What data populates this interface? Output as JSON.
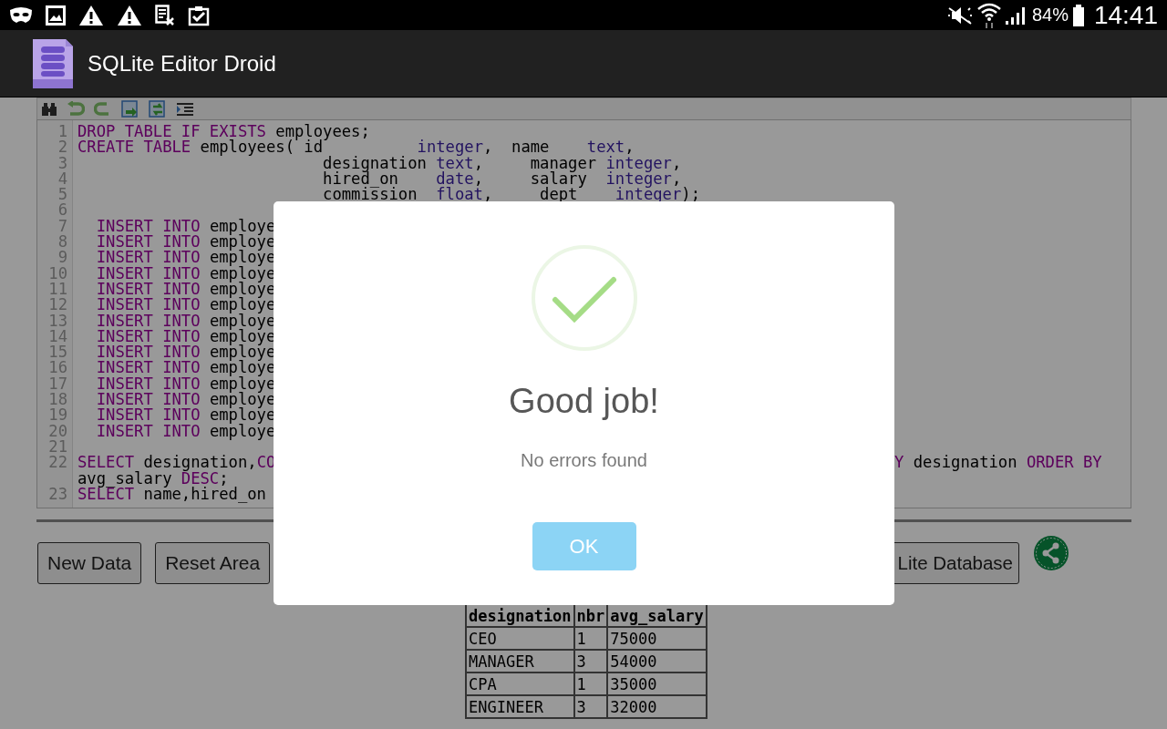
{
  "status_bar": {
    "battery": "84%",
    "time": "14:41"
  },
  "app_bar": {
    "title": "SQLite Editor Droid"
  },
  "editor": {
    "lines": [
      {
        "number": "1",
        "parts": [
          {
            "text": "DROP TABLE IF EXISTS",
            "kind": "keyword"
          },
          {
            "text": " employees;",
            "kind": "plain"
          }
        ]
      },
      {
        "number": "2",
        "parts": [
          {
            "text": "CREATE TABLE",
            "kind": "keyword"
          },
          {
            "text": " employees( id          ",
            "kind": "plain"
          },
          {
            "text": "integer",
            "kind": "type"
          },
          {
            "text": ",  name    ",
            "kind": "plain"
          },
          {
            "text": "text",
            "kind": "type"
          },
          {
            "text": ",",
            "kind": "plain"
          }
        ]
      },
      {
        "number": "3",
        "parts": [
          {
            "text": "                          designation ",
            "kind": "plain"
          },
          {
            "text": "text",
            "kind": "type"
          },
          {
            "text": ",     manager ",
            "kind": "plain"
          },
          {
            "text": "integer",
            "kind": "type"
          },
          {
            "text": ",",
            "kind": "plain"
          }
        ]
      },
      {
        "number": "4",
        "parts": [
          {
            "text": "                          hired_on    ",
            "kind": "plain"
          },
          {
            "text": "date",
            "kind": "type"
          },
          {
            "text": ",     salary  ",
            "kind": "plain"
          },
          {
            "text": "integer",
            "kind": "type"
          },
          {
            "text": ",",
            "kind": "plain"
          }
        ]
      },
      {
        "number": "5",
        "parts": [
          {
            "text": "                          commission  ",
            "kind": "plain"
          },
          {
            "text": "float",
            "kind": "type"
          },
          {
            "text": ",     dept    ",
            "kind": "plain"
          },
          {
            "text": "integer",
            "kind": "type"
          },
          {
            "text": ");",
            "kind": "plain"
          }
        ]
      },
      {
        "number": "6"
      },
      {
        "number": "7",
        "parts": [
          {
            "text": "  INSERT INTO",
            "kind": "keyword"
          },
          {
            "text": " employe",
            "kind": "plain"
          }
        ]
      },
      {
        "number": "8",
        "parts": [
          {
            "text": "  INSERT INTO",
            "kind": "keyword"
          },
          {
            "text": " employe",
            "kind": "plain"
          }
        ]
      },
      {
        "number": "9",
        "parts": [
          {
            "text": "  INSERT INTO",
            "kind": "keyword"
          },
          {
            "text": " employe",
            "kind": "plain"
          }
        ]
      },
      {
        "number": "10",
        "parts": [
          {
            "text": "  INSERT INTO",
            "kind": "keyword"
          },
          {
            "text": " employe",
            "kind": "plain"
          }
        ]
      },
      {
        "number": "11",
        "parts": [
          {
            "text": "  INSERT INTO",
            "kind": "keyword"
          },
          {
            "text": " employe",
            "kind": "plain"
          }
        ]
      },
      {
        "number": "12",
        "parts": [
          {
            "text": "  INSERT INTO",
            "kind": "keyword"
          },
          {
            "text": " employe",
            "kind": "plain"
          }
        ]
      },
      {
        "number": "13",
        "parts": [
          {
            "text": "  INSERT INTO",
            "kind": "keyword"
          },
          {
            "text": " employe",
            "kind": "plain"
          }
        ]
      },
      {
        "number": "14",
        "parts": [
          {
            "text": "  INSERT INTO",
            "kind": "keyword"
          },
          {
            "text": " employe",
            "kind": "plain"
          }
        ]
      },
      {
        "number": "15",
        "parts": [
          {
            "text": "  INSERT INTO",
            "kind": "keyword"
          },
          {
            "text": " employe",
            "kind": "plain"
          }
        ]
      },
      {
        "number": "16",
        "parts": [
          {
            "text": "  INSERT INTO",
            "kind": "keyword"
          },
          {
            "text": " employe",
            "kind": "plain"
          }
        ]
      },
      {
        "number": "17",
        "parts": [
          {
            "text": "  INSERT INTO",
            "kind": "keyword"
          },
          {
            "text": " employe",
            "kind": "plain"
          }
        ]
      },
      {
        "number": "18",
        "parts": [
          {
            "text": "  INSERT INTO",
            "kind": "keyword"
          },
          {
            "text": " employe",
            "kind": "plain"
          }
        ]
      },
      {
        "number": "19",
        "parts": [
          {
            "text": "  INSERT INTO",
            "kind": "keyword"
          },
          {
            "text": " employe",
            "kind": "plain"
          }
        ]
      },
      {
        "number": "20",
        "parts": [
          {
            "text": "  INSERT INTO",
            "kind": "keyword"
          },
          {
            "text": " employe",
            "kind": "plain"
          }
        ]
      },
      {
        "number": "21"
      },
      {
        "number": "22",
        "parts": [
          {
            "text": "SELECT",
            "kind": "keyword"
          },
          {
            "text": " designation,",
            "kind": "plain"
          },
          {
            "text": "CO",
            "kind": "keyword"
          }
        ],
        "right": [
          {
            "text": "Y",
            "kind": "keyword"
          },
          {
            "text": " designation ",
            "kind": "plain"
          },
          {
            "text": "ORDER BY",
            "kind": "keyword"
          }
        ]
      },
      {
        "parts": [
          {
            "text": "avg_salary ",
            "kind": "plain"
          },
          {
            "text": "DESC",
            "kind": "keyword"
          },
          {
            "text": ";",
            "kind": "plain"
          }
        ]
      },
      {
        "number": "23",
        "parts": [
          {
            "text": "SELECT",
            "kind": "keyword"
          },
          {
            "text": " name,hired_on",
            "kind": "plain"
          }
        ]
      }
    ]
  },
  "buttons": [
    {
      "label": "New Data"
    },
    {
      "label": "Reset Area"
    },
    {
      "label": "Lite Database"
    }
  ],
  "result_table": {
    "columns": [
      "designation",
      "nbr",
      "avg_salary"
    ],
    "rows": [
      [
        "CEO",
        "1",
        "75000"
      ],
      [
        "MANAGER",
        "3",
        "54000"
      ],
      [
        "CPA",
        "1",
        "35000"
      ],
      [
        "ENGINEER",
        "3",
        "32000"
      ]
    ]
  },
  "dialog": {
    "title": "Good job!",
    "message": "No errors found",
    "button": "OK"
  }
}
